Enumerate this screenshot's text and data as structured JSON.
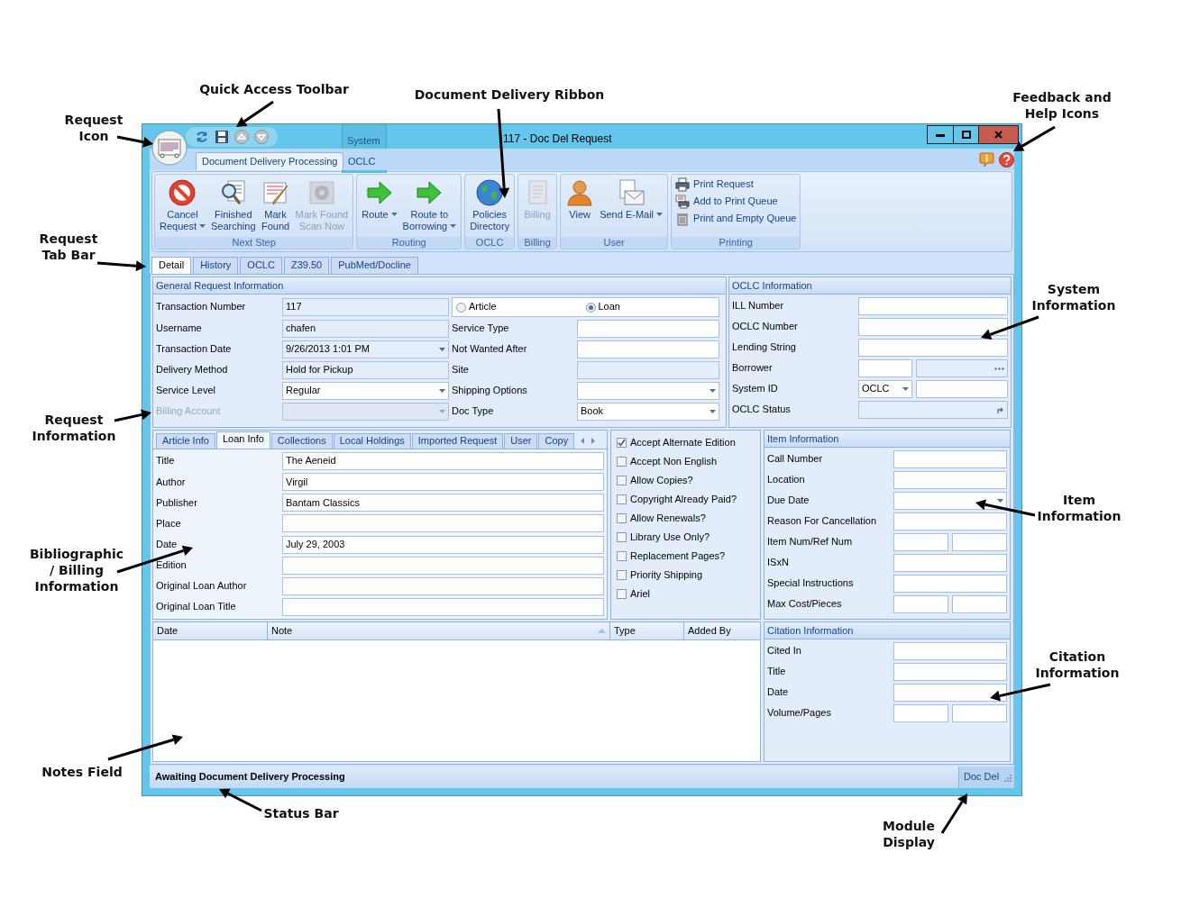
{
  "window": {
    "title": "117 - Doc Del Request"
  },
  "context_tab_group": {
    "label": "System"
  },
  "ribbon_tabs": [
    {
      "label": "Document Delivery Processing",
      "selected": true
    },
    {
      "label": "OCLC",
      "selected": false
    }
  ],
  "ribbon_groups": [
    {
      "label": "Next Step",
      "kind": "large",
      "buttons": [
        {
          "label": "Cancel\nRequest",
          "dropdown": true,
          "disabled": false
        },
        {
          "label": "Finished\nSearching",
          "dropdown": false,
          "disabled": false
        },
        {
          "label": "Mark\nFound",
          "dropdown": false,
          "disabled": false
        },
        {
          "label": "Mark Found\nScan Now",
          "dropdown": false,
          "disabled": true
        }
      ]
    },
    {
      "label": "Routing",
      "kind": "large",
      "buttons": [
        {
          "label": "Route",
          "dropdown": true,
          "disabled": false
        },
        {
          "label": "Route to\nBorrowing",
          "dropdown": true,
          "disabled": false
        }
      ]
    },
    {
      "label": "OCLC",
      "kind": "large",
      "buttons": [
        {
          "label": "Policies\nDirectory",
          "dropdown": false,
          "disabled": false
        }
      ]
    },
    {
      "label": "Billing",
      "kind": "large",
      "buttons": [
        {
          "label": "Billing",
          "dropdown": false,
          "disabled": true
        }
      ]
    },
    {
      "label": "User",
      "kind": "large",
      "buttons": [
        {
          "label": "View",
          "dropdown": false,
          "disabled": false
        },
        {
          "label": "Send E-Mail",
          "dropdown": true,
          "disabled": false
        }
      ]
    },
    {
      "label": "Printing",
      "kind": "small",
      "buttons": [
        {
          "label": "Print Request",
          "dropdown": false,
          "disabled": false
        },
        {
          "label": "Add to Print Queue",
          "dropdown": false,
          "disabled": false
        },
        {
          "label": "Print and Empty Queue",
          "dropdown": false,
          "disabled": false
        }
      ]
    }
  ],
  "request_tabs": [
    {
      "label": "Detail",
      "selected": true
    },
    {
      "label": "History",
      "selected": false
    },
    {
      "label": "OCLC",
      "selected": false
    },
    {
      "label": "Z39.50",
      "selected": false
    },
    {
      "label": "PubMed/Docline",
      "selected": false
    }
  ],
  "general_info": {
    "title": "General Request Information",
    "left_fields": [
      {
        "label": "Transaction Number",
        "value": "117",
        "kind": "readonly"
      },
      {
        "label": "Username",
        "value": "chafen",
        "kind": "readonly"
      },
      {
        "label": "Transaction Date",
        "value": "9/26/2013 1:01 PM",
        "kind": "readonly-select"
      },
      {
        "label": "Delivery Method",
        "value": "Hold for Pickup",
        "kind": "readonly"
      },
      {
        "label": "Service Level",
        "value": "Regular",
        "kind": "select"
      },
      {
        "label": "Billing Account",
        "kind": "disabled-select"
      }
    ],
    "request_type": [
      {
        "label": "Article",
        "selected": false
      },
      {
        "label": "Loan",
        "selected": true
      }
    ],
    "right_fields": [
      {
        "label": "Service Type",
        "kind": "text"
      },
      {
        "label": "Not Wanted After",
        "kind": "text"
      },
      {
        "label": "Site",
        "kind": "readonly"
      },
      {
        "label": "Shipping Options",
        "kind": "select"
      },
      {
        "label": "Doc Type",
        "value": "Book",
        "kind": "select"
      }
    ]
  },
  "oclc_info": {
    "title": "OCLC Information",
    "fields": [
      {
        "label": "ILL Number",
        "kind": "text"
      },
      {
        "label": "OCLC Number",
        "kind": "text"
      },
      {
        "label": "Lending String",
        "kind": "text"
      },
      {
        "label": "Borrower",
        "kind": "lookup"
      },
      {
        "label": "System ID",
        "value": "OCLC",
        "kind": "select-text"
      },
      {
        "label": "OCLC Status",
        "kind": "readonly-action"
      }
    ]
  },
  "detail_tabs": [
    {
      "label": "Article Info",
      "selected": false
    },
    {
      "label": "Loan Info",
      "selected": true
    },
    {
      "label": "Collections",
      "selected": false
    },
    {
      "label": "Local Holdings",
      "selected": false
    },
    {
      "label": "Imported Request",
      "selected": false
    },
    {
      "label": "User",
      "selected": false
    },
    {
      "label": "Copy",
      "selected": false
    }
  ],
  "loan_info_fields": [
    {
      "label": "Title",
      "value": "The Aeneid"
    },
    {
      "label": "Author",
      "value": "Virgil"
    },
    {
      "label": "Publisher",
      "value": "Bantam Classics"
    },
    {
      "label": "Place"
    },
    {
      "label": "Date",
      "value": "July 29, 2003"
    },
    {
      "label": "Edition"
    },
    {
      "label": "Original Loan Author"
    },
    {
      "label": "Original Loan Title"
    }
  ],
  "options": [
    {
      "label": "Accept Alternate Edition",
      "checked": true
    },
    {
      "label": "Accept Non English",
      "checked": false
    },
    {
      "label": "Allow Copies?",
      "checked": false
    },
    {
      "label": "Copyright Already Paid?",
      "checked": false
    },
    {
      "label": "Allow Renewals?",
      "checked": false
    },
    {
      "label": "Library Use Only?",
      "checked": false
    },
    {
      "label": "Replacement Pages?",
      "checked": false
    },
    {
      "label": "Priority Shipping",
      "checked": false
    },
    {
      "label": "Ariel",
      "checked": false
    }
  ],
  "item_info": {
    "title": "Item Information",
    "fields": [
      {
        "label": "Call Number",
        "kind": "text"
      },
      {
        "label": "Location",
        "kind": "text"
      },
      {
        "label": "Due Date",
        "kind": "select"
      },
      {
        "label": "Reason For Cancellation",
        "kind": "text"
      },
      {
        "label": "Item Num/Ref Num",
        "kind": "pair"
      },
      {
        "label": "ISxN",
        "kind": "text"
      },
      {
        "label": "Special Instructions",
        "kind": "text"
      },
      {
        "label": "Max Cost/Pieces",
        "kind": "pair"
      }
    ]
  },
  "notes": {
    "columns": [
      {
        "label": "Date",
        "sorted": false
      },
      {
        "label": "Note",
        "sorted": true
      },
      {
        "label": "Type",
        "sorted": false
      },
      {
        "label": "Added By",
        "sorted": false
      }
    ]
  },
  "citation_info": {
    "title": "Citation Information",
    "fields": [
      {
        "label": "Cited In",
        "kind": "text"
      },
      {
        "label": "Title",
        "kind": "text"
      },
      {
        "label": "Date",
        "kind": "text"
      },
      {
        "label": "Volume/Pages",
        "kind": "pair"
      }
    ]
  },
  "status_bar": {
    "message": "Awaiting Document Delivery Processing",
    "module": "Doc Del"
  },
  "annotations": [
    {
      "text": "Quick Access Toolbar"
    },
    {
      "text": "Document Delivery Ribbon"
    },
    {
      "text": "Feedback and\nHelp Icons"
    },
    {
      "text": "Request\nIcon"
    },
    {
      "text": "Request\nTab Bar"
    },
    {
      "text": "System\nInformation"
    },
    {
      "text": "Request\nInformation"
    },
    {
      "text": "Item\nInformation"
    },
    {
      "text": "Bibliographic\n/ Billing\nInformation"
    },
    {
      "text": "Citation\nInformation"
    },
    {
      "text": "Notes Field"
    },
    {
      "text": "Status Bar"
    },
    {
      "text": "Module\nDisplay"
    }
  ]
}
